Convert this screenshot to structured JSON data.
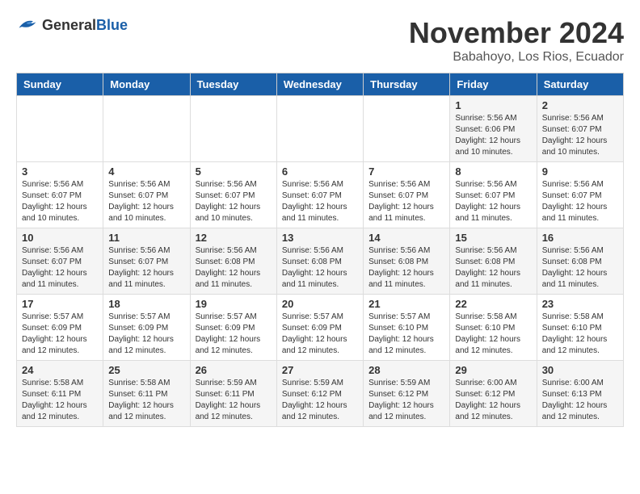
{
  "header": {
    "logo_general": "General",
    "logo_blue": "Blue",
    "month_title": "November 2024",
    "location": "Babahoyo, Los Rios, Ecuador"
  },
  "weekdays": [
    "Sunday",
    "Monday",
    "Tuesday",
    "Wednesday",
    "Thursday",
    "Friday",
    "Saturday"
  ],
  "weeks": [
    [
      {
        "day": "",
        "info": ""
      },
      {
        "day": "",
        "info": ""
      },
      {
        "day": "",
        "info": ""
      },
      {
        "day": "",
        "info": ""
      },
      {
        "day": "",
        "info": ""
      },
      {
        "day": "1",
        "info": "Sunrise: 5:56 AM\nSunset: 6:06 PM\nDaylight: 12 hours\nand 10 minutes."
      },
      {
        "day": "2",
        "info": "Sunrise: 5:56 AM\nSunset: 6:07 PM\nDaylight: 12 hours\nand 10 minutes."
      }
    ],
    [
      {
        "day": "3",
        "info": "Sunrise: 5:56 AM\nSunset: 6:07 PM\nDaylight: 12 hours\nand 10 minutes."
      },
      {
        "day": "4",
        "info": "Sunrise: 5:56 AM\nSunset: 6:07 PM\nDaylight: 12 hours\nand 10 minutes."
      },
      {
        "day": "5",
        "info": "Sunrise: 5:56 AM\nSunset: 6:07 PM\nDaylight: 12 hours\nand 10 minutes."
      },
      {
        "day": "6",
        "info": "Sunrise: 5:56 AM\nSunset: 6:07 PM\nDaylight: 12 hours\nand 11 minutes."
      },
      {
        "day": "7",
        "info": "Sunrise: 5:56 AM\nSunset: 6:07 PM\nDaylight: 12 hours\nand 11 minutes."
      },
      {
        "day": "8",
        "info": "Sunrise: 5:56 AM\nSunset: 6:07 PM\nDaylight: 12 hours\nand 11 minutes."
      },
      {
        "day": "9",
        "info": "Sunrise: 5:56 AM\nSunset: 6:07 PM\nDaylight: 12 hours\nand 11 minutes."
      }
    ],
    [
      {
        "day": "10",
        "info": "Sunrise: 5:56 AM\nSunset: 6:07 PM\nDaylight: 12 hours\nand 11 minutes."
      },
      {
        "day": "11",
        "info": "Sunrise: 5:56 AM\nSunset: 6:07 PM\nDaylight: 12 hours\nand 11 minutes."
      },
      {
        "day": "12",
        "info": "Sunrise: 5:56 AM\nSunset: 6:08 PM\nDaylight: 12 hours\nand 11 minutes."
      },
      {
        "day": "13",
        "info": "Sunrise: 5:56 AM\nSunset: 6:08 PM\nDaylight: 12 hours\nand 11 minutes."
      },
      {
        "day": "14",
        "info": "Sunrise: 5:56 AM\nSunset: 6:08 PM\nDaylight: 12 hours\nand 11 minutes."
      },
      {
        "day": "15",
        "info": "Sunrise: 5:56 AM\nSunset: 6:08 PM\nDaylight: 12 hours\nand 11 minutes."
      },
      {
        "day": "16",
        "info": "Sunrise: 5:56 AM\nSunset: 6:08 PM\nDaylight: 12 hours\nand 11 minutes."
      }
    ],
    [
      {
        "day": "17",
        "info": "Sunrise: 5:57 AM\nSunset: 6:09 PM\nDaylight: 12 hours\nand 12 minutes."
      },
      {
        "day": "18",
        "info": "Sunrise: 5:57 AM\nSunset: 6:09 PM\nDaylight: 12 hours\nand 12 minutes."
      },
      {
        "day": "19",
        "info": "Sunrise: 5:57 AM\nSunset: 6:09 PM\nDaylight: 12 hours\nand 12 minutes."
      },
      {
        "day": "20",
        "info": "Sunrise: 5:57 AM\nSunset: 6:09 PM\nDaylight: 12 hours\nand 12 minutes."
      },
      {
        "day": "21",
        "info": "Sunrise: 5:57 AM\nSunset: 6:10 PM\nDaylight: 12 hours\nand 12 minutes."
      },
      {
        "day": "22",
        "info": "Sunrise: 5:58 AM\nSunset: 6:10 PM\nDaylight: 12 hours\nand 12 minutes."
      },
      {
        "day": "23",
        "info": "Sunrise: 5:58 AM\nSunset: 6:10 PM\nDaylight: 12 hours\nand 12 minutes."
      }
    ],
    [
      {
        "day": "24",
        "info": "Sunrise: 5:58 AM\nSunset: 6:11 PM\nDaylight: 12 hours\nand 12 minutes."
      },
      {
        "day": "25",
        "info": "Sunrise: 5:58 AM\nSunset: 6:11 PM\nDaylight: 12 hours\nand 12 minutes."
      },
      {
        "day": "26",
        "info": "Sunrise: 5:59 AM\nSunset: 6:11 PM\nDaylight: 12 hours\nand 12 minutes."
      },
      {
        "day": "27",
        "info": "Sunrise: 5:59 AM\nSunset: 6:12 PM\nDaylight: 12 hours\nand 12 minutes."
      },
      {
        "day": "28",
        "info": "Sunrise: 5:59 AM\nSunset: 6:12 PM\nDaylight: 12 hours\nand 12 minutes."
      },
      {
        "day": "29",
        "info": "Sunrise: 6:00 AM\nSunset: 6:12 PM\nDaylight: 12 hours\nand 12 minutes."
      },
      {
        "day": "30",
        "info": "Sunrise: 6:00 AM\nSunset: 6:13 PM\nDaylight: 12 hours\nand 12 minutes."
      }
    ]
  ]
}
